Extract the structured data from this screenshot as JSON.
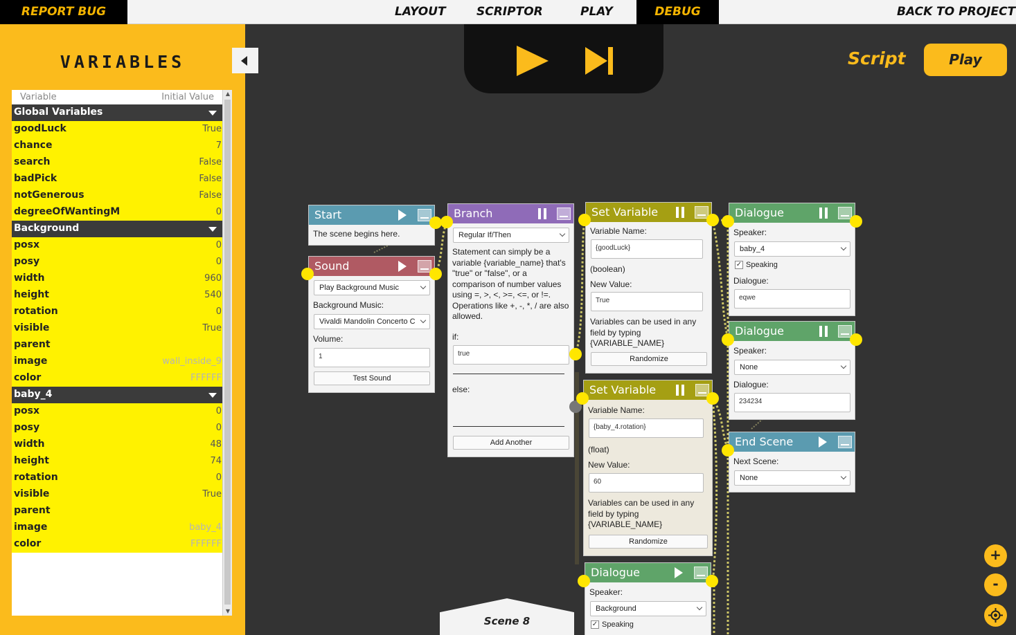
{
  "topbar": {
    "report_bug": "REPORT BUG",
    "layout": "LAYOUT",
    "scriptor": "SCRIPTOR",
    "play": "PLAY",
    "debug": "DEBUG",
    "back": "BACK TO PROJECT"
  },
  "variables": {
    "title": "VARIABLES",
    "col_variable": "Variable",
    "col_initial": "Initial Value",
    "groups": [
      {
        "name": "Global Variables",
        "rows": [
          {
            "name": "goodLuck",
            "value": "True"
          },
          {
            "name": "chance",
            "value": "7"
          },
          {
            "name": "search",
            "value": "False"
          },
          {
            "name": "badPick",
            "value": "False"
          },
          {
            "name": "notGenerous",
            "value": "False"
          },
          {
            "name": "degreeOfWantingM",
            "value": "0"
          }
        ]
      },
      {
        "name": "Background",
        "rows": [
          {
            "name": "posx",
            "value": "0"
          },
          {
            "name": "posy",
            "value": "0"
          },
          {
            "name": "width",
            "value": "960"
          },
          {
            "name": "height",
            "value": "540"
          },
          {
            "name": "rotation",
            "value": "0"
          },
          {
            "name": "visible",
            "value": "True"
          },
          {
            "name": "parent",
            "value": ""
          },
          {
            "name": "image",
            "value": "wall_inside_9"
          },
          {
            "name": "color",
            "value": "FFFFFF"
          }
        ]
      },
      {
        "name": "baby_4",
        "rows": [
          {
            "name": "posx",
            "value": "0"
          },
          {
            "name": "posy",
            "value": "0"
          },
          {
            "name": "width",
            "value": "48"
          },
          {
            "name": "height",
            "value": "74"
          },
          {
            "name": "rotation",
            "value": "0"
          },
          {
            "name": "visible",
            "value": "True"
          },
          {
            "name": "parent",
            "value": ""
          },
          {
            "name": "image",
            "value": "baby_4"
          },
          {
            "name": "color",
            "value": "FFFFFF"
          }
        ]
      }
    ]
  },
  "header": {
    "script_label": "Script",
    "play_button": "Play"
  },
  "colors": {
    "accent": "#fbbb1c",
    "connector": "#ffe600",
    "start": "#5b9bb0",
    "sound": "#b05a63",
    "branch": "#8f6bb8",
    "setvar": "#a59f13",
    "dialogue": "#5fa469",
    "endscene": "#5b9bb0"
  },
  "nodes": {
    "start": {
      "title": "Start",
      "text": "The scene begins here."
    },
    "sound": {
      "title": "Sound",
      "action": "Play Background Music",
      "music_label": "Background Music:",
      "music": "Vivaldi Mandolin Concerto C",
      "volume_label": "Volume:",
      "volume": "1",
      "test_button": "Test Sound"
    },
    "branch": {
      "title": "Branch",
      "mode": "Regular If/Then",
      "description": "Statement can simply be a variable {variable_name} that's \"true\" or \"false\", or a comparison of number values using =, >, <, >=, <=, or !=. Operations like +, -, *, / are also allowed.",
      "if_label": "if:",
      "if_value": "true",
      "else_label": "else:",
      "add_button": "Add Another"
    },
    "setvar1": {
      "title": "Set Variable",
      "name_label": "Variable Name:",
      "name": "{goodLuck}",
      "type": "(boolean)",
      "value_label": "New Value:",
      "value": "True",
      "hint": "Variables can be used in any field by typing {VARIABLE_NAME}",
      "randomize": "Randomize"
    },
    "setvar2": {
      "title": "Set Variable",
      "name_label": "Variable Name:",
      "name": "{baby_4.rotation}",
      "type": "(float)",
      "value_label": "New Value:",
      "value": "60",
      "hint": "Variables can be used in any field by typing {VARIABLE_NAME}",
      "randomize": "Randomize"
    },
    "dialogue1": {
      "title": "Dialogue",
      "speaker_label": "Speaker:",
      "speaker": "baby_4",
      "speaking_label": "Speaking",
      "dialogue_label": "Dialogue:",
      "dialogue": "eqwe"
    },
    "dialogue2": {
      "title": "Dialogue",
      "speaker_label": "Speaker:",
      "speaker": "None",
      "dialogue_label": "Dialogue:",
      "dialogue": "234234"
    },
    "endscene": {
      "title": "End Scene",
      "next_label": "Next Scene:",
      "next": "None"
    },
    "dialogue3": {
      "title": "Dialogue",
      "speaker_label": "Speaker:",
      "speaker": "Background",
      "speaking_label": "Speaking"
    }
  },
  "scene_tab": "Scene 8",
  "zoom": {
    "in": "+",
    "out": "-"
  }
}
